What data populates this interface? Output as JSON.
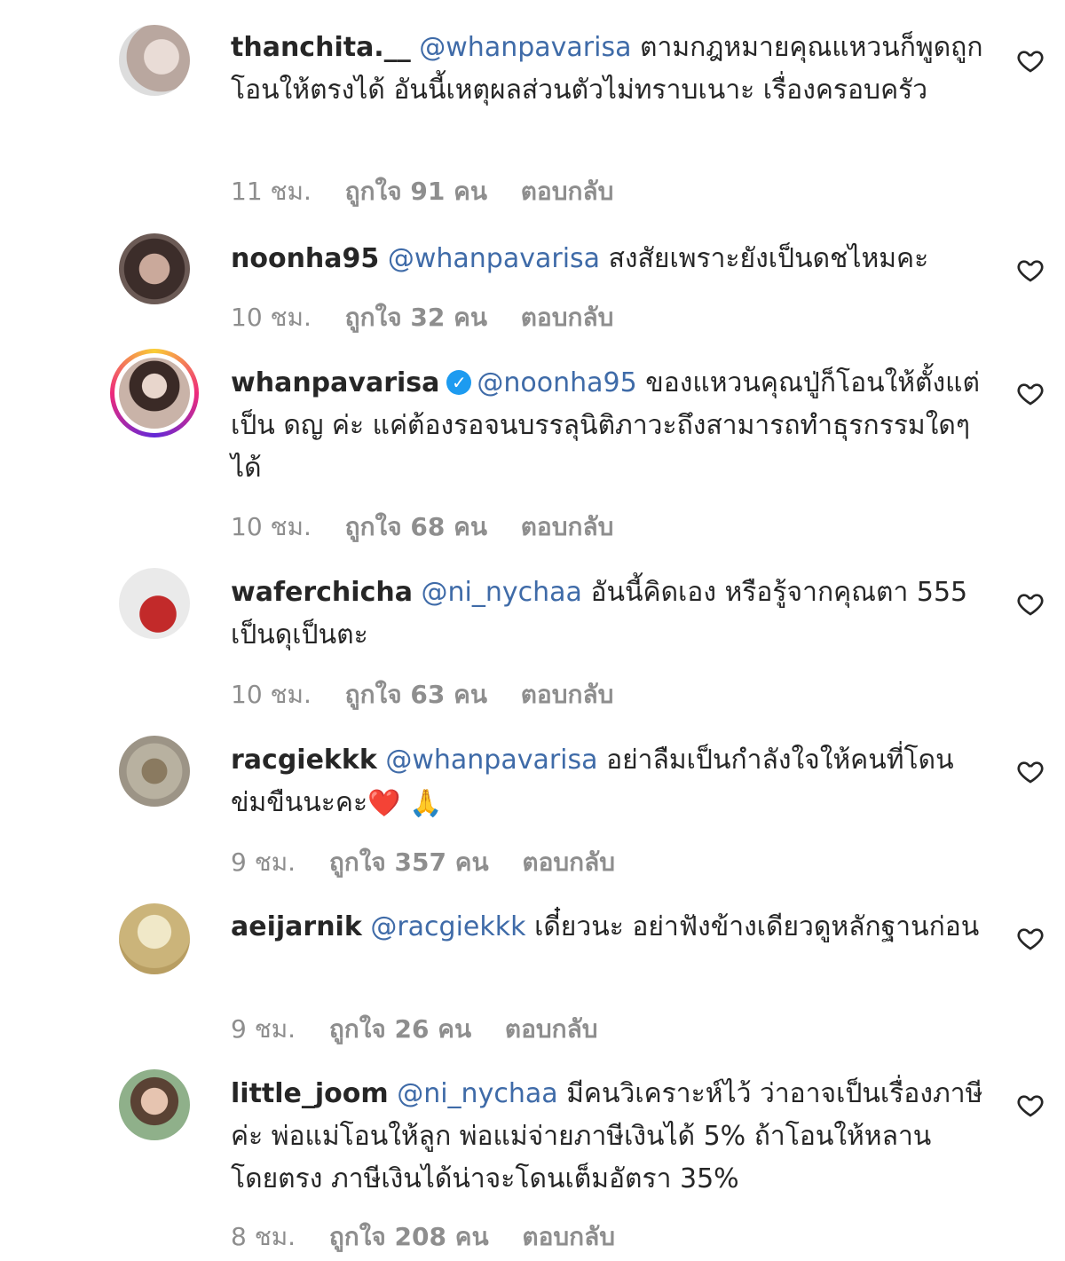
{
  "comments": [
    {
      "username": "thanchita.__",
      "mention": "@whanpavarisa",
      "text": "ตามกฎหมายคุณแหวนก็พูดถูก โอนให้ตรงได้ อันนี้เหตุผลส่วนตัวไม่ทราบเนาะ เรื่องครอบครัว",
      "time": "11 ชม.",
      "likes": "ถูกใจ 91 คน",
      "reply": "ตอบกลับ",
      "avatar_icon": "profile-photo"
    },
    {
      "username": "noonha95",
      "mention": "@whanpavarisa",
      "text": "สงสัยเพราะยังเป็นดชไหมคะ",
      "time": "10 ชม.",
      "likes": "ถูกใจ 32 คน",
      "reply": "ตอบกลับ",
      "avatar_icon": "profile-photo"
    },
    {
      "username": "whanpavarisa",
      "verified": true,
      "mention": "@noonha95",
      "text": "ของแหวนคุณปู่ก็โอนให้ตั้งแต่เป็น ดญ ค่ะ แค่ต้องรอจนบรรลุนิติภาวะถึงสามารถทำธุรกรรมใดๆได้",
      "time": "10 ชม.",
      "likes": "ถูกใจ 68 คน",
      "reply": "ตอบกลับ",
      "avatar_icon": "story-ring-profile-photo"
    },
    {
      "username": "waferchicha",
      "mention": "@ni_nychaa",
      "text": "อันนี้คิดเอง หรือรู้จากคุณตา 555 เป็นดุเป็นตะ",
      "time": "10 ชม.",
      "likes": "ถูกใจ 63 คน",
      "reply": "ตอบกลับ",
      "avatar_icon": "profile-photo"
    },
    {
      "username": "racgiekkk",
      "mention": "@whanpavarisa",
      "text": "อย่าลืมเป็นกำลังใจให้คนที่โดนข่มขืนนะคะ",
      "emoji": "❤️ 🙏",
      "time": "9 ชม.",
      "likes": "ถูกใจ 357 คน",
      "reply": "ตอบกลับ",
      "avatar_icon": "profile-photo"
    },
    {
      "username": "aeijarnik",
      "mention": "@racgiekkk",
      "text": "เดี๋ยวนะ อย่าฟังข้างเดียวดูหลักฐานก่อน",
      "time": "9 ชม.",
      "likes": "ถูกใจ 26 คน",
      "reply": "ตอบกลับ",
      "avatar_icon": "profile-photo"
    },
    {
      "username": "little_joom",
      "mention": "@ni_nychaa",
      "text": "มีคนวิเคราะห์ไว้ ว่าอาจเป็นเรื่องภาษีค่ะ พ่อแม่โอนให้ลูก พ่อแม่จ่ายภาษีเงินได้ 5% ถ้าโอนให้หลานโดยตรง ภาษีเงินได้น่าจะโดนเต็มอัตรา 35%",
      "time": "8 ชม.",
      "likes": "ถูกใจ 208 คน",
      "reply": "ตอบกลับ",
      "avatar_icon": "profile-photo"
    }
  ],
  "colors": {
    "mention": "#3f6ba8",
    "meta": "#8e8e8e",
    "verified": "#1d9bf0",
    "heart_outline": "#262626"
  },
  "icons": {
    "like": "heart-outline-icon",
    "verified": "verified-badge-icon"
  }
}
